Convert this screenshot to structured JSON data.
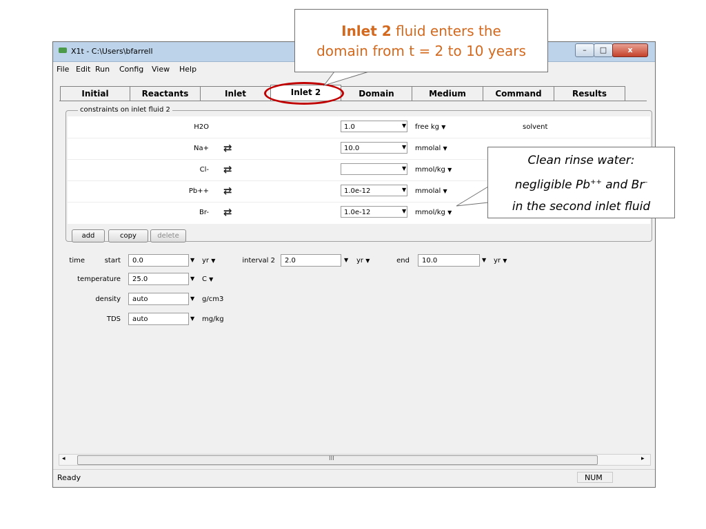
{
  "window": {
    "title": "X1t - C:\\Users\\bfarrell",
    "controls": {
      "minimize": "–",
      "maximize": "□",
      "close": "x"
    }
  },
  "menu": [
    "File",
    "Edit",
    "Run",
    "Config",
    "View",
    "Help"
  ],
  "tabs": [
    {
      "label": "Initial",
      "active": false
    },
    {
      "label": "Reactants",
      "active": false
    },
    {
      "label": "Inlet",
      "active": false
    },
    {
      "label": "Inlet 2",
      "active": true
    },
    {
      "label": "Domain",
      "active": false
    },
    {
      "label": "Medium",
      "active": false
    },
    {
      "label": "Command",
      "active": false
    },
    {
      "label": "Results",
      "active": false
    }
  ],
  "constraints": {
    "group_label": "constraints on inlet fluid 2",
    "rows": [
      {
        "name": "H2O",
        "swap": false,
        "value": "1.0",
        "unit": "free kg",
        "note": "solvent"
      },
      {
        "name": "Na+",
        "swap": true,
        "value": "10.0",
        "unit": "mmolal",
        "note": ""
      },
      {
        "name": "Cl-",
        "swap": true,
        "value": "",
        "unit": "mmol/kg",
        "note": ""
      },
      {
        "name": "Pb++",
        "swap": true,
        "value": "1.0e-12",
        "unit": "mmolal",
        "note": ""
      },
      {
        "name": "Br-",
        "swap": true,
        "value": "1.0e-12",
        "unit": "mmol/kg",
        "note": ""
      }
    ],
    "buttons": {
      "add": "add",
      "copy": "copy",
      "delete": "delete"
    }
  },
  "time": {
    "label": "time",
    "start_label": "start",
    "start_value": "0.0",
    "start_unit": "yr",
    "interval_label": "interval 2",
    "interval_value": "2.0",
    "interval_unit": "yr",
    "end_label": "end",
    "end_value": "10.0",
    "end_unit": "yr"
  },
  "temperature": {
    "label": "temperature",
    "value": "25.0",
    "unit": "C"
  },
  "density": {
    "label": "density",
    "value": "auto",
    "unit": "g/cm3"
  },
  "tds": {
    "label": "TDS",
    "value": "auto",
    "unit": "mg/kg"
  },
  "scrollbar": {
    "grip": "III"
  },
  "status": {
    "text": "Ready",
    "num": "NUM"
  },
  "callouts": {
    "top": {
      "bold": "Inlet 2",
      "line1_rest": " fluid enters the",
      "line2": "domain from t = 2 to 10 years"
    },
    "right": {
      "line1": "Clean rinse water:",
      "line2_pre": "negligible Pb",
      "line2_sup1": "++",
      "line2_mid": " and Br",
      "line2_sup2": "–",
      "line3": "in the second inlet fluid"
    }
  },
  "colors": {
    "callout_accent": "#d2691e",
    "highlight_oval": "#c00000"
  }
}
